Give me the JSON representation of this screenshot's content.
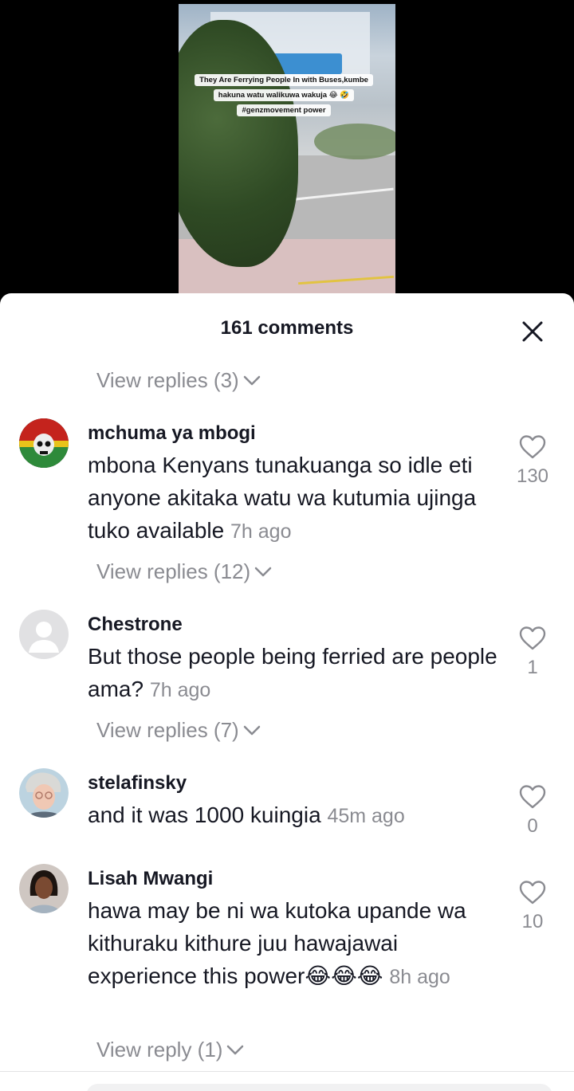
{
  "video": {
    "caption_line1": "They Are Ferrying People In with Buses,kumbe",
    "caption_line2": "hakuna watu walikuwa wakuja 😂 🤣",
    "caption_line3": "#genzmovement power"
  },
  "comments_sheet": {
    "title": "161 comments",
    "close_icon": "close-icon",
    "top_view_replies": "View replies (3)",
    "comments": [
      {
        "username": "mchuma ya mbogi",
        "text": "mbona Kenyans tunakuanga so idle eti anyone akitaka watu wa kutumia ujinga tuko available",
        "time": "7h ago",
        "likes": "130",
        "view_replies": "View replies (12)",
        "avatar_icon": "skull-avatar"
      },
      {
        "username": "Chestrone",
        "text": "But those people being ferried are people ama?",
        "time": "7h ago",
        "likes": "1",
        "view_replies": "View replies (7)",
        "avatar_icon": "default-avatar"
      },
      {
        "username": "stelafinsky",
        "text": "and it was 1000 kuingia",
        "time": "45m ago",
        "likes": "0",
        "view_replies": "",
        "avatar_icon": "photo-avatar"
      },
      {
        "username": "Lisah Mwangi",
        "text": "hawa may be ni wa kutoka upande wa kithuraku kithure juu hawajawai experience this power😂😂😂",
        "time": "8h ago",
        "likes": "10",
        "view_replies": "View reply (1)",
        "avatar_icon": "photo-avatar"
      }
    ]
  },
  "colors": {
    "primary_text": "#161823",
    "secondary_text": "#8a8b91",
    "background": "#ffffff"
  }
}
